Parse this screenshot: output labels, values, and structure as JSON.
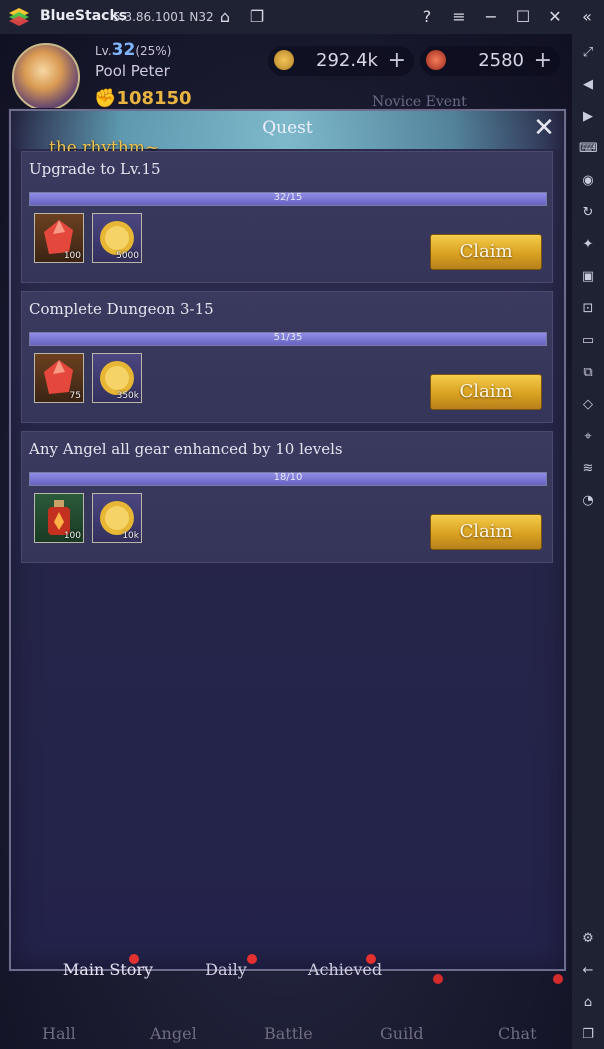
{
  "window": {
    "app_name": "BlueStacks",
    "version": "5.3.86.1001 N32"
  },
  "hud": {
    "level_prefix": "Lv.",
    "level": "32",
    "level_pct": "(25%)",
    "player_name": "Pool Peter",
    "power": "108150",
    "gold": "292.4k",
    "gems": "2580"
  },
  "bg": {
    "event_banner": "Novice Event"
  },
  "dialog": {
    "title": "Quest",
    "marquee": "the rhythm~",
    "claim_label": "Claim",
    "quests": [
      {
        "title": "Upgrade to Lv.15",
        "progress_text": "32/15",
        "progress_fraction": 1.0,
        "rewards": [
          {
            "icon": "red-gem-icon",
            "qty": "100"
          },
          {
            "icon": "gold-coin-icon",
            "qty": "5000"
          }
        ]
      },
      {
        "title": "Complete Dungeon 3-15",
        "progress_text": "51/35",
        "progress_fraction": 1.0,
        "rewards": [
          {
            "icon": "red-gem-icon",
            "qty": "75"
          },
          {
            "icon": "gold-coin-icon",
            "qty": "350k"
          }
        ]
      },
      {
        "title": "Any Angel all gear enhanced by 10 levels",
        "progress_text": "18/10",
        "progress_fraction": 1.0,
        "rewards": [
          {
            "icon": "potion-bottle-icon",
            "qty": "100"
          },
          {
            "icon": "gold-coin-icon",
            "qty": "10k"
          }
        ]
      }
    ],
    "tabs": [
      {
        "label": "Main Story"
      },
      {
        "label": "Daily"
      },
      {
        "label": "Achieved"
      }
    ]
  },
  "bottom_nav": [
    {
      "label": "Hall"
    },
    {
      "label": "Angel"
    },
    {
      "label": "Battle"
    },
    {
      "label": "Guild"
    },
    {
      "label": "Chat"
    }
  ],
  "colors": {
    "claim": "#d9a221",
    "progress_fill": "#7674d4",
    "notification_dot": "#e33030"
  }
}
